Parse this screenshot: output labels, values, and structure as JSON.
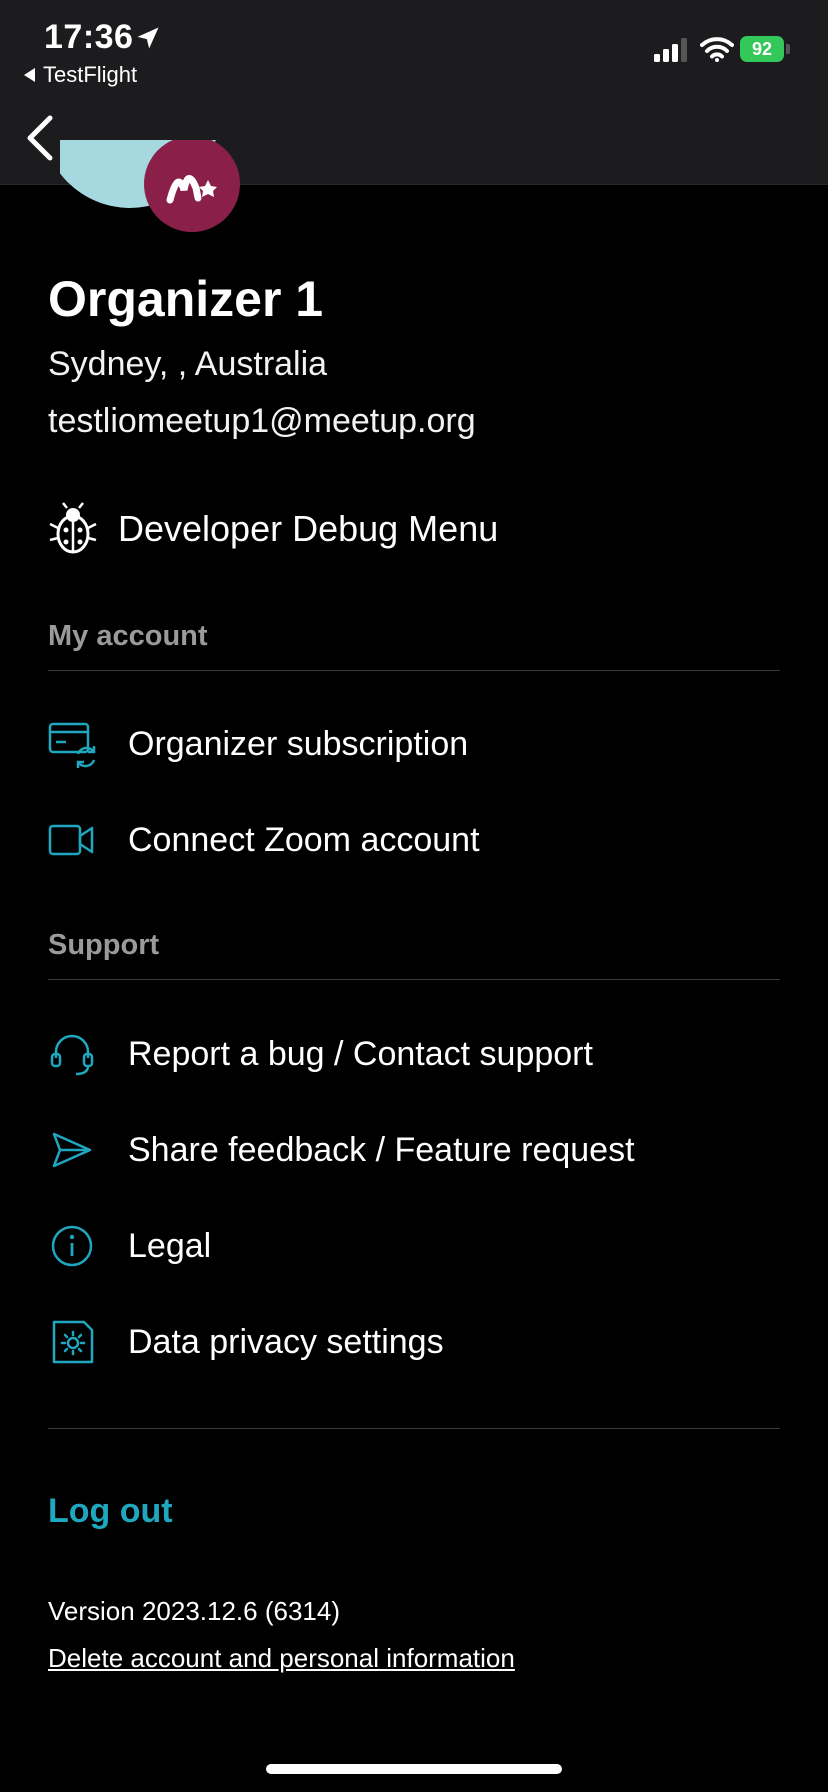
{
  "status_bar": {
    "time": "17:36",
    "back_app": "TestFlight",
    "battery": "92",
    "icons": [
      "location-arrow-icon",
      "signal-icon",
      "wifi-icon",
      "battery-icon"
    ]
  },
  "nav": {
    "back_icon": "chevron-left-icon"
  },
  "profile": {
    "name": "Organizer 1",
    "location": "Sydney, , Australia",
    "email": "testliomeetup1@meetup.org",
    "avatar_colors": {
      "circle": "#a6d8df",
      "badge": "#8a1f4a"
    }
  },
  "debug": {
    "label": "Developer Debug Menu",
    "icon": "bug-icon"
  },
  "sections": {
    "account": {
      "header": "My account",
      "items": [
        {
          "label": "Organizer subscription",
          "icon": "card-refresh-icon"
        },
        {
          "label": "Connect Zoom account",
          "icon": "video-camera-icon"
        }
      ]
    },
    "support": {
      "header": "Support",
      "items": [
        {
          "label": "Report a bug / Contact support",
          "icon": "headset-icon"
        },
        {
          "label": "Share feedback / Feature request",
          "icon": "send-icon"
        },
        {
          "label": "Legal",
          "icon": "info-icon"
        },
        {
          "label": "Data privacy settings",
          "icon": "privacy-settings-icon"
        }
      ]
    }
  },
  "footer": {
    "logout": "Log out",
    "version": "Version 2023.12.6 (6314)",
    "delete": "Delete account and personal information"
  },
  "colors": {
    "accent": "#1ea7bf",
    "background": "#000000",
    "header_bg": "#1c1c1e",
    "section_header": "#9a9a9a"
  }
}
